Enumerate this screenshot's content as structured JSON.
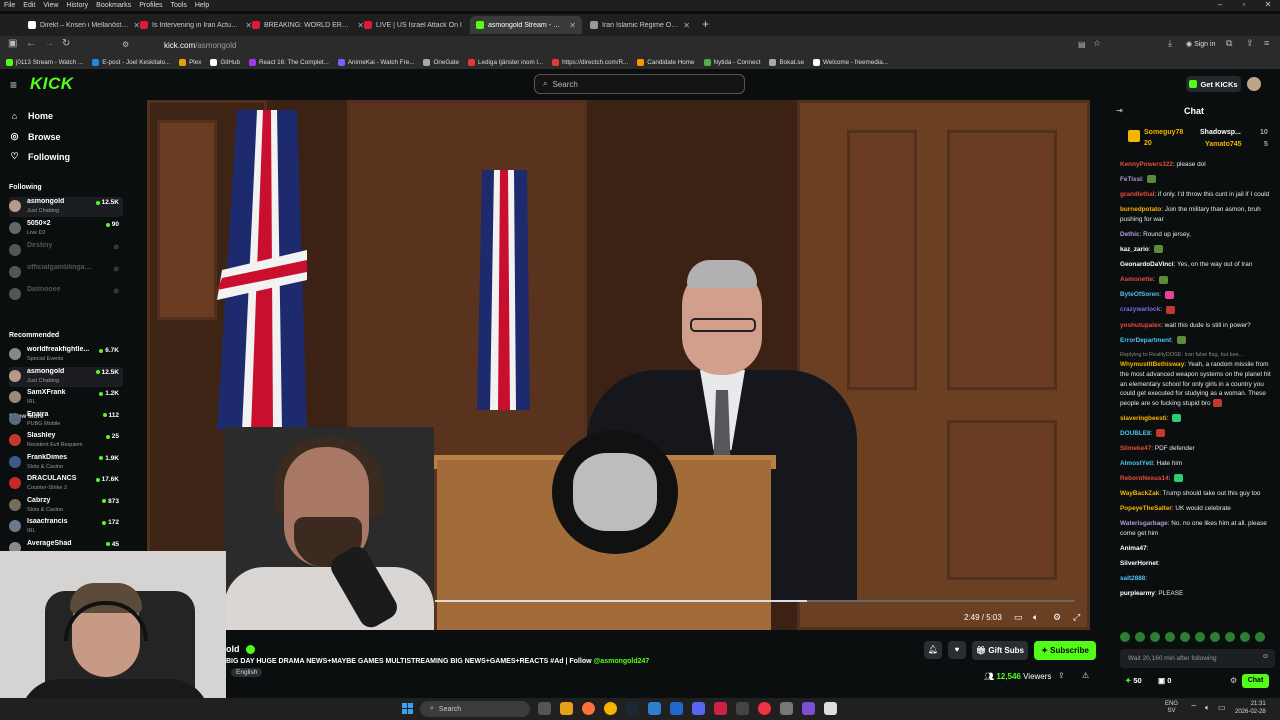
{
  "browser": {
    "menu": [
      "File",
      "Edit",
      "View",
      "History",
      "Bookmarks",
      "Profiles",
      "Tools",
      "Help"
    ],
    "tabs": [
      {
        "label": "Direkt – Krisen i Mellanöstern –",
        "color": "#ffffff"
      },
      {
        "label": "Is Intervening in Iran Actually J",
        "color": "#e3163e"
      },
      {
        "label": "BREAKING: WORLD ERUPTS AS",
        "color": "#e3163e"
      },
      {
        "label": "LIVE | US Israel Attack On I",
        "color": "#e3163e"
      },
      {
        "label": "asmongold Stream - Watc",
        "color": "#53fc18"
      },
      {
        "label": "Iran Islamic Regime Overview",
        "color": "#999999"
      }
    ],
    "url_host": "kick.com",
    "url_path": "/asmongold",
    "signin": "Sign in",
    "bookmarks": [
      {
        "label": "j0113 Stream - Watch ...",
        "color": "#53fc18"
      },
      {
        "label": "E-post - Joel Keskitalo...",
        "color": "#1e88e5"
      },
      {
        "label": "Plex",
        "color": "#e5a00d"
      },
      {
        "label": "GitHub",
        "color": "#ffffff"
      },
      {
        "label": "React 16: The Complet...",
        "color": "#a435f0"
      },
      {
        "label": "AnimeKai - Watch Fre...",
        "color": "#7b5cff"
      },
      {
        "label": "OneGate",
        "color": "#aaaaaa"
      },
      {
        "label": "Lediga tjänster inom l...",
        "color": "#e53935"
      },
      {
        "label": "https://directch.com/R...",
        "color": "#e53935"
      },
      {
        "label": "Candidate Home",
        "color": "#ff9800"
      },
      {
        "label": "Nytida - Connect",
        "color": "#4caf50"
      },
      {
        "label": "Bokat.se",
        "color": "#aaaaaa"
      },
      {
        "label": "Welcome - freemedia...",
        "color": "#ffffff"
      }
    ]
  },
  "header": {
    "logo": "KICK",
    "search_placeholder": "Search",
    "get_kicks": "Get KICKs"
  },
  "sidebar": {
    "nav": [
      {
        "label": "Home",
        "icon": "home-icon"
      },
      {
        "label": "Browse",
        "icon": "compass-icon"
      },
      {
        "label": "Following",
        "icon": "heart-icon"
      }
    ],
    "following_title": "Following",
    "following": [
      {
        "name": "asmongold",
        "category": "Just Chatting",
        "viewers": "12.5K",
        "live": true,
        "color": "#b89a8a"
      },
      {
        "name": "5050×2",
        "category": "Live DJ",
        "viewers": "90",
        "live": true,
        "color": "#666666"
      },
      {
        "name": "Destiny",
        "category": "",
        "viewers": "",
        "live": false,
        "color": "#555555"
      },
      {
        "name": "officialgamblingacad...",
        "category": "",
        "viewers": "",
        "live": false,
        "color": "#555555"
      },
      {
        "name": "Dalmooee",
        "category": "",
        "viewers": "",
        "live": false,
        "color": "#555555"
      }
    ],
    "show_more": "Show More",
    "recommended_title": "Recommended",
    "recommended": [
      {
        "name": "worldfreakfightle...",
        "category": "Special Events",
        "viewers": "6.7K",
        "color": "#888888"
      },
      {
        "name": "asmongold",
        "category": "Just Chatting",
        "viewers": "12.5K",
        "color": "#b89a8a"
      },
      {
        "name": "SamXFrank",
        "category": "IRL",
        "viewers": "1.2K",
        "color": "#9a8a7a"
      },
      {
        "name": "Enaira",
        "category": "PUBG Mobile",
        "viewers": "112",
        "color": "#5a6a7a"
      },
      {
        "name": "Slashley",
        "category": "Resident Evil Requiem",
        "viewers": "25",
        "color": "#c0392b"
      },
      {
        "name": "FrankDimes",
        "category": "Slots & Casino",
        "viewers": "1.9K",
        "color": "#3a5a8a"
      },
      {
        "name": "DRACULANCS",
        "category": "Counter-Strike 2",
        "viewers": "17.6K",
        "color": "#c62828"
      },
      {
        "name": "Cabrzy",
        "category": "Slots & Casino",
        "viewers": "873",
        "color": "#7a6a5a"
      },
      {
        "name": "Isaacfrancis",
        "category": "IRL",
        "viewers": "172",
        "color": "#6a7a8a"
      },
      {
        "name": "AverageShad",
        "category": "",
        "viewers": "45",
        "color": "#8a8a8a"
      }
    ]
  },
  "player": {
    "timecode": "2:49 / 5:03",
    "progress": 0.83
  },
  "stream": {
    "name": "old",
    "title": "BIG DAY HUGE DRAMA NEWS+MAYBE GAMES MULTISTREAMING BIG NEWS+GAMES+REACTS #Ad | Follow ",
    "title_handle": "@asmongold247",
    "language": "English",
    "gift_subs": "Gift Subs",
    "subscribe": "Subscribe",
    "viewers": "12,546",
    "viewers_label": "Viewers"
  },
  "chat": {
    "title": "Chat",
    "gifters": [
      {
        "name": "Someguy78",
        "count": "20",
        "color": "#f5b400"
      },
      {
        "name": "Shadowsp...",
        "count": "10",
        "color": "#ffffff"
      },
      {
        "name": "Yamato745",
        "count": "5",
        "color": "#f5b400"
      }
    ],
    "messages": [
      {
        "user": "KennyPowers322",
        "color": "#e74c3c",
        "text": "please dol"
      },
      {
        "user": "FeTissi",
        "color": "#b19cd9",
        "text": "",
        "emote": "#5a8a3a"
      },
      {
        "user": "grandlethal",
        "color": "#e74c3c",
        "text": "if only. I'd throw this cunt in jail if I could"
      },
      {
        "user": "burnedpotato",
        "color": "#f5b400",
        "text": "Join the military than asmon, bruh pushing for war"
      },
      {
        "user": "Dethic",
        "color": "#b19cd9",
        "text": "Round up jersey,"
      },
      {
        "user": "kaz_zario",
        "color": "#ffffff",
        "text": "",
        "emote": "#5a8a3a"
      },
      {
        "user": "GeonardoDaVinci",
        "color": "#ffffff",
        "text": "Yes, on the way out of Iran"
      },
      {
        "user": "Asmonette",
        "color": "#e74c3c",
        "text": "",
        "emote": "#5a8a3a"
      },
      {
        "user": "ByteOfSoren",
        "color": "#4fc3f7",
        "text": "",
        "emote": "#e84393"
      },
      {
        "user": "crazywarlock",
        "color": "#7b68ee",
        "text": "",
        "emote": "#c0392b"
      },
      {
        "user": "yoshutupalex",
        "color": "#e74c3c",
        "text": "wait this dude is still in power?"
      },
      {
        "user": "ErrorDepartment",
        "color": "#4fc3f7",
        "text": "",
        "emote": "#5a8a3a"
      },
      {
        "user": "WhymustItBethisway",
        "color": "#f5b400",
        "reply": "Replying to RealityDOSE: Iran false flag, but kee...",
        "text": "Yeah, a random missile from the most advanced weapon systems on the planet hit an elementary school for only girls in a country you could get executed for studying as a woman. These people are so fucking stupid bro",
        "emote": "#c0392b"
      },
      {
        "user": "slaveringbeesti",
        "color": "#f5b400",
        "text": "",
        "emote": "#2ecc71"
      },
      {
        "user": "DOUBLE8",
        "color": "#4fc3f7",
        "text": "",
        "emote": "#c0392b"
      },
      {
        "user": "Slimeke47",
        "color": "#e74c3c",
        "text": "PDF defender"
      },
      {
        "user": "AlmostYeti",
        "color": "#4fc3f7",
        "text": "Hate him"
      },
      {
        "user": "RebornNexus14",
        "color": "#e74c3c",
        "text": "",
        "emote": "#2ecc71"
      },
      {
        "user": "WayBackZak",
        "color": "#f5b400",
        "text": "Trump should take out this guy too"
      },
      {
        "user": "PopeyeTheSalter",
        "color": "#f5b400",
        "text": "UK would celebrate"
      },
      {
        "user": "Waterisgarbage",
        "color": "#b19cd9",
        "text": "No. no one likes him at all. please come get him"
      },
      {
        "user": "Anima47",
        "color": "#ffffff",
        "text": ""
      },
      {
        "user": "SilverHornet",
        "color": "#ffffff",
        "text": ""
      },
      {
        "user": "salt2888",
        "color": "#4fc3f7",
        "text": ""
      },
      {
        "user": "purplearmy",
        "color": "#ffffff",
        "text": "PLEASE"
      }
    ],
    "input_placeholder": "Wait 20,160 min after following",
    "kicks": "50",
    "subs": "0",
    "send": "Chat"
  },
  "taskbar": {
    "search": "Search",
    "lang": "ENG",
    "region": "SV",
    "time": "21:31",
    "date": "2026-02-28"
  }
}
